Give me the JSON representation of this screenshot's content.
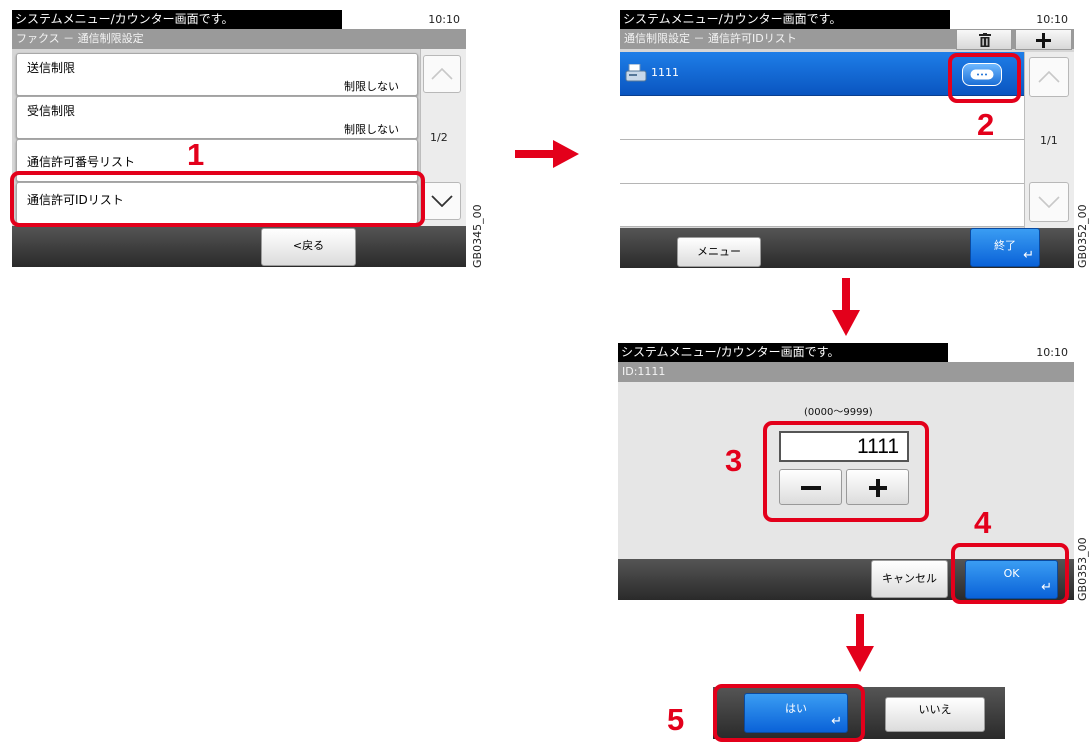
{
  "common": {
    "status_message": "システムメニュー/カウンター画面です。",
    "clock": "10:10"
  },
  "screen1": {
    "code": "GB0345_00",
    "subtitle": "ファクス － 通信制限設定",
    "items": [
      {
        "label": "送信制限",
        "value": "制限しない"
      },
      {
        "label": "受信制限",
        "value": "制限しない"
      },
      {
        "label": "通信許可番号リスト",
        "value": ""
      },
      {
        "label": "通信許可IDリスト",
        "value": ""
      }
    ],
    "page": "1/2",
    "back_label": "<戻る"
  },
  "screen2": {
    "code": "GB0352_00",
    "subtitle": "通信制限設定 － 通信許可IDリスト",
    "selected_entry": "1111",
    "page": "1/1",
    "menu_label": "メニュー",
    "finish_label": "終了"
  },
  "screen3": {
    "code": "GB0353_00",
    "subtitle": "ID:1111",
    "range_hint": "(0000～9999)",
    "id_value": "1111",
    "cancel_label": "キャンセル",
    "ok_label": "OK"
  },
  "dialog": {
    "yes_label": "はい",
    "no_label": "いいえ"
  },
  "steps": [
    "1",
    "2",
    "3",
    "4",
    "5"
  ],
  "colors": {
    "highlight": "#e3001b",
    "accent_blue": "#0a62d8"
  },
  "icons": [
    "fax-icon",
    "trash-icon",
    "plus-icon",
    "details-icon",
    "enter-icon",
    "chevron-up-icon",
    "chevron-down-icon",
    "arrow-right-icon",
    "arrow-down-icon"
  ]
}
